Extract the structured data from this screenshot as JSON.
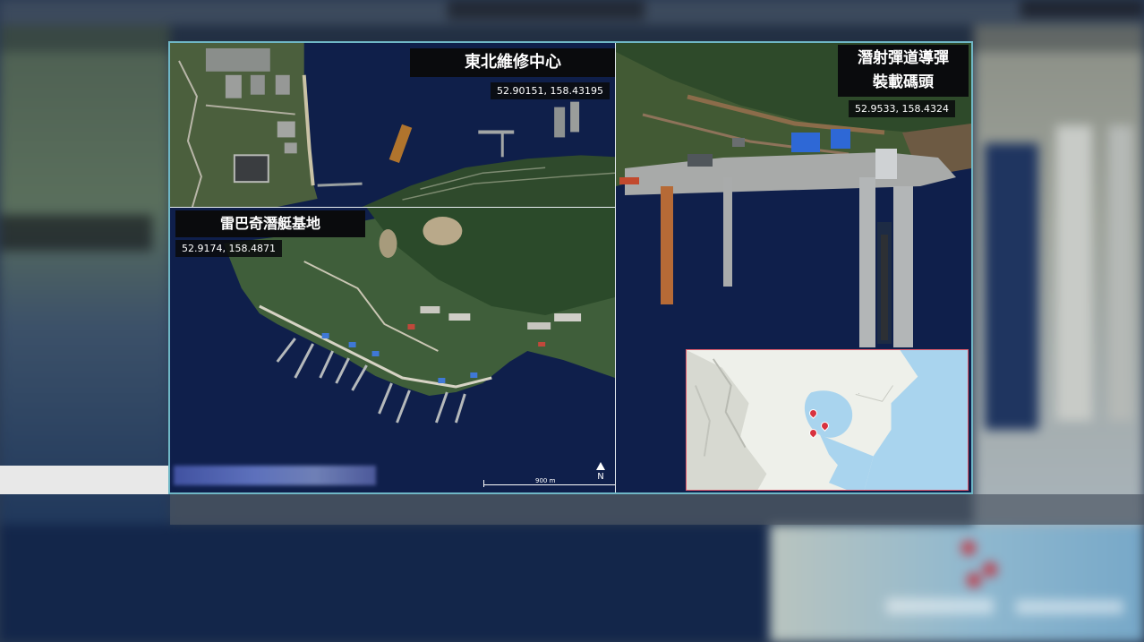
{
  "panels": {
    "northeast_repair_center": {
      "title": "東北維修中心",
      "coordinates": "52.90151, 158.43195"
    },
    "rybachiy_submarine_base": {
      "title": "雷巴奇潛艇基地",
      "coordinates": "52.9174, 158.4871"
    },
    "missile_loading_pier": {
      "title_line1": "潛射彈道導彈",
      "title_line2": "裝載碼頭",
      "coordinates": "52.9533, 158.4324"
    }
  },
  "map_controls": {
    "north_label": "N",
    "scale_label": "900 m"
  },
  "inset_map": {
    "marker_count": 3,
    "marker_color": "#d8323f",
    "water_color": "#a9d4ee",
    "land_color": "#eef0ea"
  },
  "colors": {
    "frame_border": "#6fb7c6",
    "title_background": "#0a0b0d",
    "inset_border": "#e05a6a",
    "sea": "#0e1e48"
  }
}
